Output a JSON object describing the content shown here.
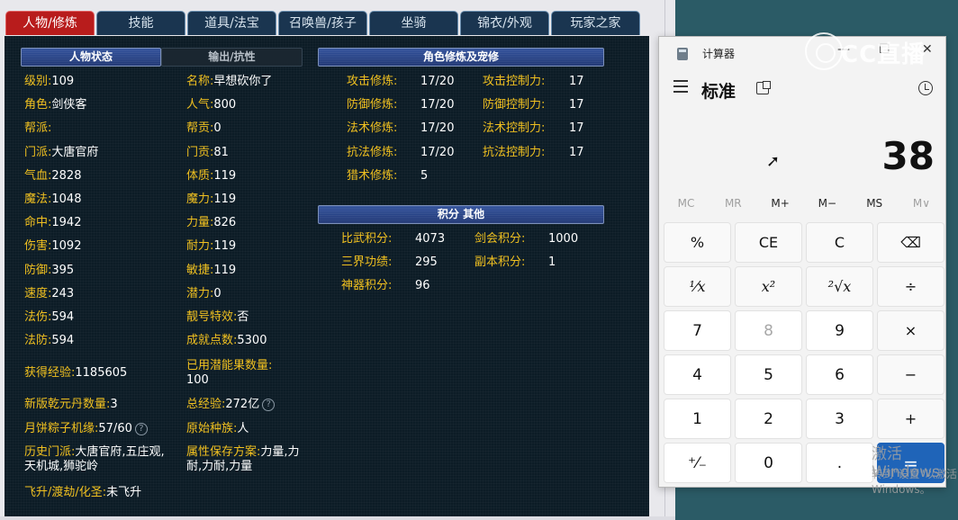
{
  "tabs": [
    {
      "label": "人物/修炼"
    },
    {
      "label": "技能"
    },
    {
      "label": "道具/法宝"
    },
    {
      "label": "召唤兽/孩子"
    },
    {
      "label": "坐骑"
    },
    {
      "label": "锦衣/外观"
    },
    {
      "label": "玩家之家"
    }
  ],
  "sections": {
    "status": "人物状态",
    "output": "输出/抗性",
    "cultivation": "角色修炼及宠修",
    "points": "积分 其他"
  },
  "col1": [
    {
      "label": "级别:",
      "value": "109"
    },
    {
      "label": "角色:",
      "value": "剑侠客"
    },
    {
      "label": "帮派:",
      "value": ""
    },
    {
      "label": "门派:",
      "value": "大唐官府"
    },
    {
      "label": "气血:",
      "value": "2828"
    },
    {
      "label": "魔法:",
      "value": "1048"
    },
    {
      "label": "命中:",
      "value": "1942"
    },
    {
      "label": "伤害:",
      "value": "1092"
    },
    {
      "label": "防御:",
      "value": "395"
    },
    {
      "label": "速度:",
      "value": "243"
    },
    {
      "label": "法伤:",
      "value": "594"
    },
    {
      "label": "法防:",
      "value": "594"
    }
  ],
  "col2": [
    {
      "label": "名称:",
      "value": "早想砍你了"
    },
    {
      "label": "人气:",
      "value": "800"
    },
    {
      "label": "帮贡:",
      "value": "0"
    },
    {
      "label": "门贡:",
      "value": "81"
    },
    {
      "label": "体质:",
      "value": "119"
    },
    {
      "label": "魔力:",
      "value": "119"
    },
    {
      "label": "力量:",
      "value": "826"
    },
    {
      "label": "耐力:",
      "value": "119"
    },
    {
      "label": "敏捷:",
      "value": "119"
    },
    {
      "label": "潜力:",
      "value": "0"
    },
    {
      "label": "靓号特效:",
      "value": "否"
    },
    {
      "label": "成就点数:",
      "value": "5300"
    }
  ],
  "extra": {
    "exp_label": "获得经验:",
    "exp_value": "1185605",
    "used_fruit_label": "已用潜能果数量:",
    "used_fruit_value": "100",
    "qianyuan_label": "新版乾元丹数量:",
    "qianyuan_value": "3",
    "total_exp_label": "总经验:",
    "total_exp_value": "272亿",
    "mooncake_label": "月饼粽子机缘:",
    "mooncake_value": "57/60",
    "race_label": "原始种族:",
    "race_value": "人",
    "history_label": "历史门派:",
    "history_value": "大唐官府,五庄观,天机城,狮驼岭",
    "attr_label": "属性保存方案:",
    "attr_value": "力量,力耐,力耐,力量",
    "ascend_label": "飞升/渡劫/化圣:",
    "ascend_value": "未飞升",
    "help_glyph": "?"
  },
  "cultivation": [
    {
      "label": "攻击修炼:",
      "value": "17/20",
      "label2": "攻击控制力:",
      "value2": "17"
    },
    {
      "label": "防御修炼:",
      "value": "17/20",
      "label2": "防御控制力:",
      "value2": "17"
    },
    {
      "label": "法术修炼:",
      "value": "17/20",
      "label2": "法术控制力:",
      "value2": "17"
    },
    {
      "label": "抗法修炼:",
      "value": "17/20",
      "label2": "抗法控制力:",
      "value2": "17"
    },
    {
      "label": "猎术修炼:",
      "value": "5",
      "label2": "",
      "value2": ""
    }
  ],
  "points": [
    {
      "label": "比武积分:",
      "value": "4073",
      "label2": "剑会积分:",
      "value2": "1000"
    },
    {
      "label": "三界功绩:",
      "value": "295",
      "label2": "副本积分:",
      "value2": "1"
    },
    {
      "label": "神器积分:",
      "value": "96",
      "label2": "",
      "value2": ""
    }
  ],
  "calculator": {
    "title": "计算器",
    "min": "—",
    "max": "☐",
    "close": "✕",
    "mode": "标准",
    "display": "38",
    "memory": [
      "MC",
      "MR",
      "M+",
      "M−",
      "MS",
      "M∨"
    ],
    "keys": [
      [
        "%",
        "CE",
        "C",
        "⌫"
      ],
      [
        "¹⁄x",
        "x²",
        "²√x",
        "÷"
      ],
      [
        "7",
        "8",
        "9",
        "×"
      ],
      [
        "4",
        "5",
        "6",
        "−"
      ],
      [
        "1",
        "2",
        "3",
        "+"
      ],
      [
        "⁺⁄₋",
        "0",
        ".",
        "="
      ]
    ]
  },
  "watermark": "CC直播",
  "activation": {
    "line1": "激活 Windows",
    "line2": "转到\"设置\"以激活 Windows。"
  }
}
